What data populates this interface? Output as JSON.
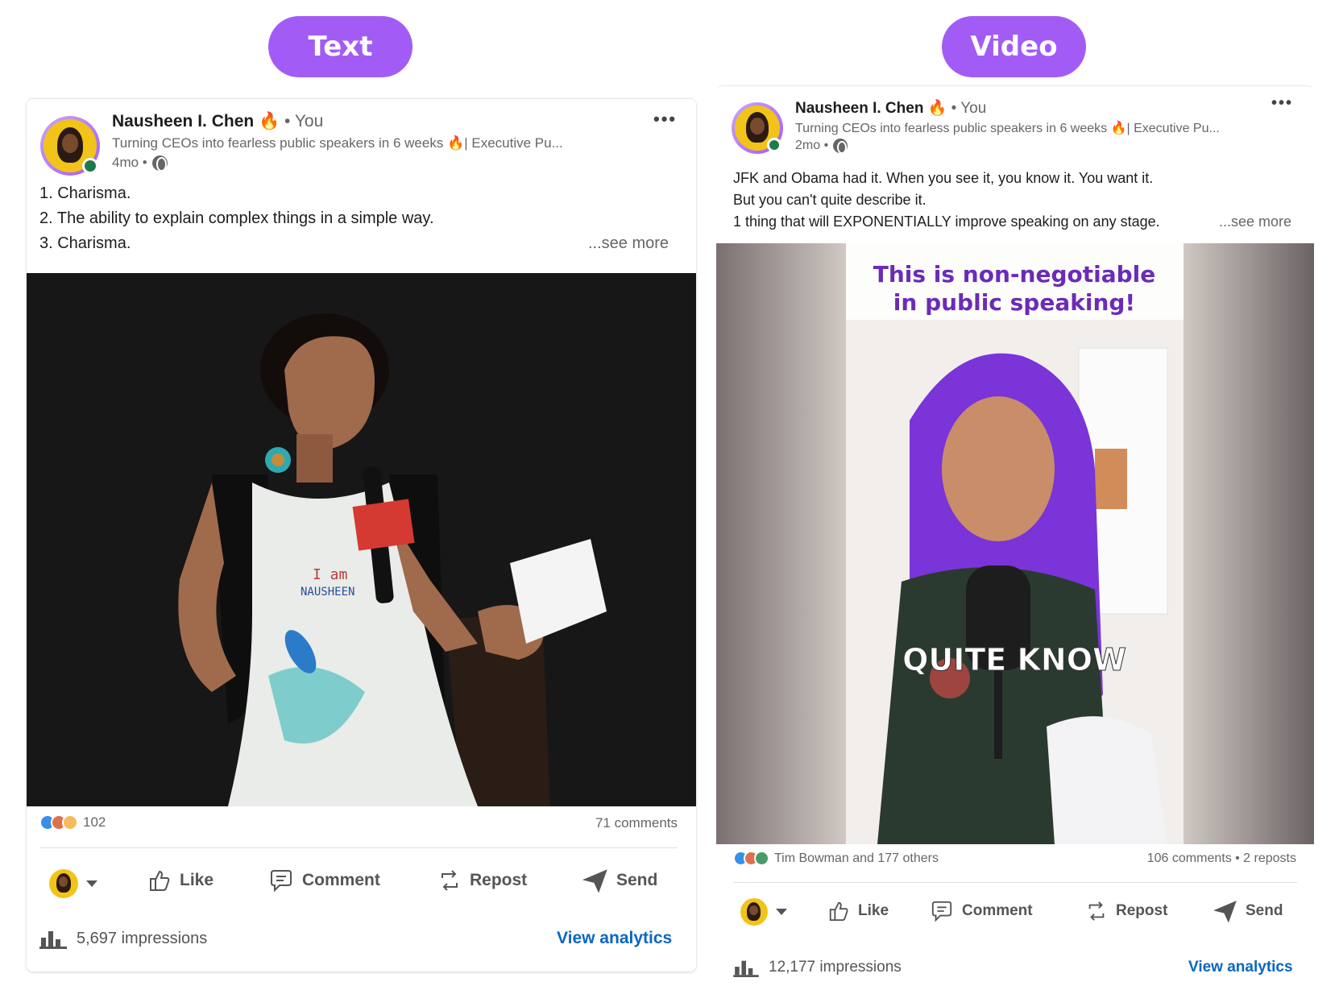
{
  "labels": {
    "text_pill": "Text",
    "video_pill": "Video"
  },
  "left_post": {
    "author": "Nausheen I. Chen",
    "fire": "🔥",
    "you": "• You",
    "headline": "Turning CEOs into fearless public speakers in 6 weeks 🔥| Executive Pu...",
    "age": "4mo •",
    "body_lines": [
      "1. Charisma.",
      "2. The ability to explain complex things in a simple way.",
      "3. Charisma."
    ],
    "see_more": "...see more",
    "reactions_count": "102",
    "comments": "71 comments",
    "actions": {
      "like": "Like",
      "comment": "Comment",
      "repost": "Repost",
      "send": "Send"
    },
    "impressions": "5,697 impressions",
    "view_analytics": "View analytics",
    "image_text": {
      "badge_line1": "I am",
      "badge_line2": "NAUSHEEN"
    }
  },
  "right_post": {
    "author": "Nausheen I. Chen",
    "fire": "🔥",
    "you": "• You",
    "headline": "Turning CEOs into fearless public speakers in 6 weeks 🔥| Executive Pu...",
    "age": "2mo •",
    "body_lines": [
      "JFK and Obama had it. When you see it, you know it. You want it.",
      "But you can't quite describe it.",
      "1 thing that will EXPONENTIALLY improve speaking on any stage."
    ],
    "see_more": "...see more",
    "reactions_text": "Tim Bowman and 177 others",
    "comments": "106 comments • 2 reposts",
    "video_title_line1": "This is non-negotiable",
    "video_title_line2": "in public speaking!",
    "video_caption": "QUITE KNOW",
    "actions": {
      "like": "Like",
      "comment": "Comment",
      "repost": "Repost",
      "send": "Send"
    },
    "impressions": "12,177 impressions",
    "view_analytics": "View analytics"
  },
  "colors": {
    "accent_purple": "#a25cf5",
    "link_blue": "#0a66c2",
    "video_text_purple": "#6b2bb8"
  }
}
